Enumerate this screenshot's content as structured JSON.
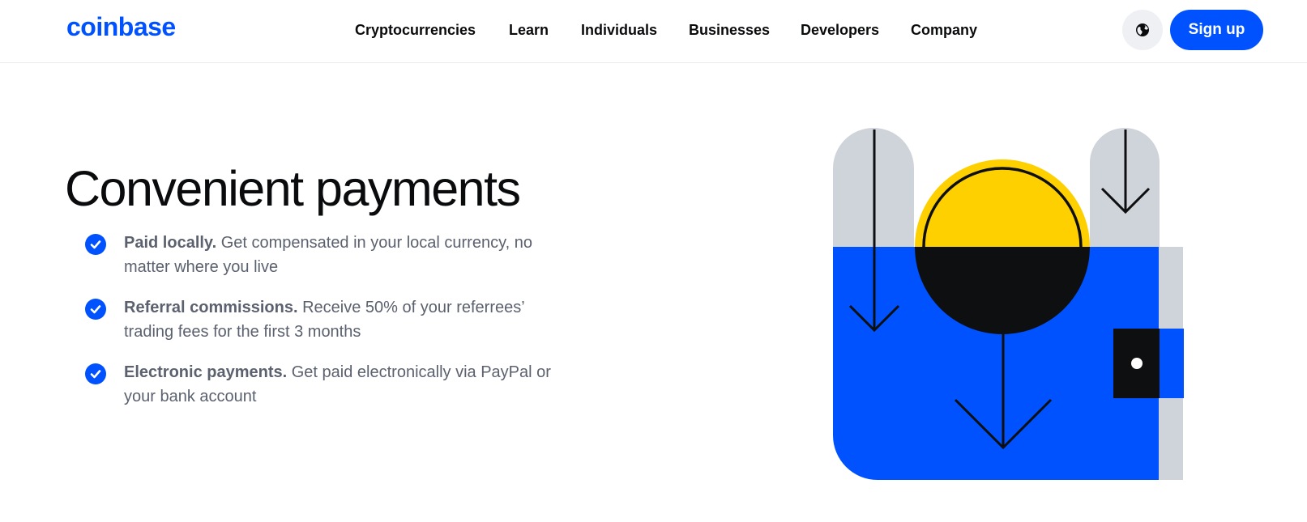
{
  "header": {
    "logo": "coinbase",
    "nav": [
      {
        "label": "Cryptocurrencies"
      },
      {
        "label": "Learn"
      },
      {
        "label": "Individuals"
      },
      {
        "label": "Businesses"
      },
      {
        "label": "Developers"
      },
      {
        "label": "Company"
      }
    ],
    "language_icon": "globe-icon",
    "signup_label": "Sign up"
  },
  "hero": {
    "title": "Convenient payments",
    "features": [
      {
        "title": "Paid locally.",
        "text": "Get compensated in your local currency, no matter where you live"
      },
      {
        "title": "Referral commissions.",
        "text": "Receive 50% of your referrees’ trading fees for the first 3 months"
      },
      {
        "title": "Electronic payments.",
        "text": "Get paid electronically via PayPal or your bank account"
      }
    ],
    "check_icon": "check-circle-icon",
    "illustration": "wallet-with-coin-and-arrows"
  },
  "colors": {
    "brand_blue": "#0052ff",
    "coin_yellow": "#ffd000",
    "ink": "#0a0b0d",
    "muted_text": "#5b616e",
    "illustration_gray": "#cfd3da"
  }
}
